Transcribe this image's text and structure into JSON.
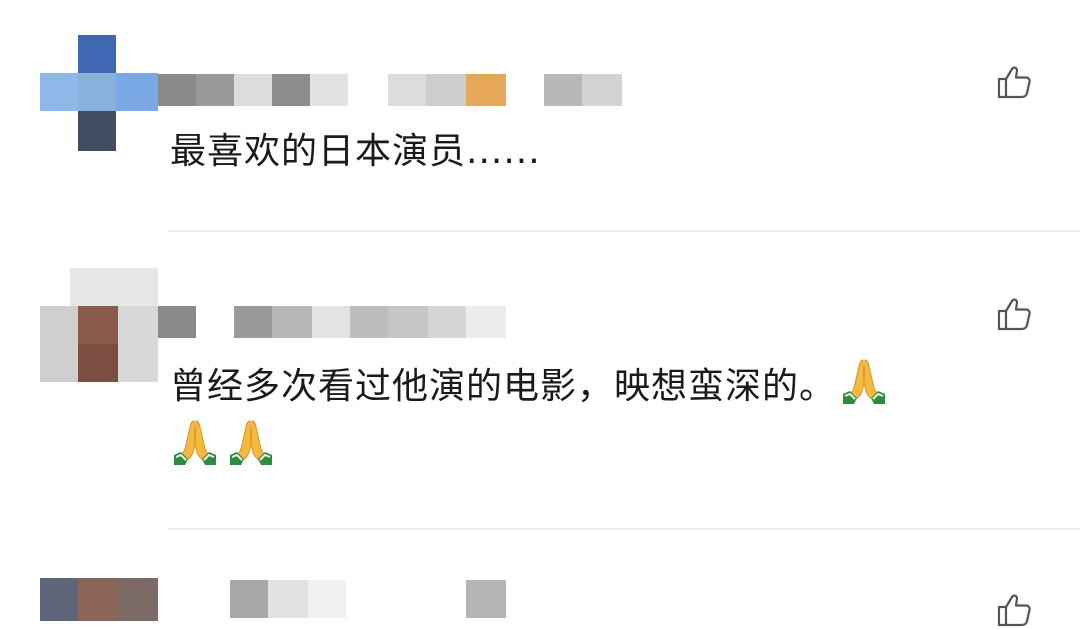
{
  "comments": [
    {
      "author": "",
      "text": "最喜欢的日本演员......",
      "emoji_count": 0,
      "like_icon": "thumbs-up-icon"
    },
    {
      "author": "",
      "text": "曾经多次看过他演的电影，映想蛮深的。",
      "emoji_count": 3,
      "emoji": "folded-hands-icon",
      "like_icon": "thumbs-up-icon"
    },
    {
      "author": "",
      "text": "",
      "emoji_count": 0,
      "like_icon": "thumbs-up-icon"
    }
  ],
  "colors": {
    "text": "#1a1a1a",
    "divider": "#ececec",
    "icon": "#555555",
    "emoji_skin": "#f5b942",
    "emoji_sleeve": "#2e8b3d"
  }
}
